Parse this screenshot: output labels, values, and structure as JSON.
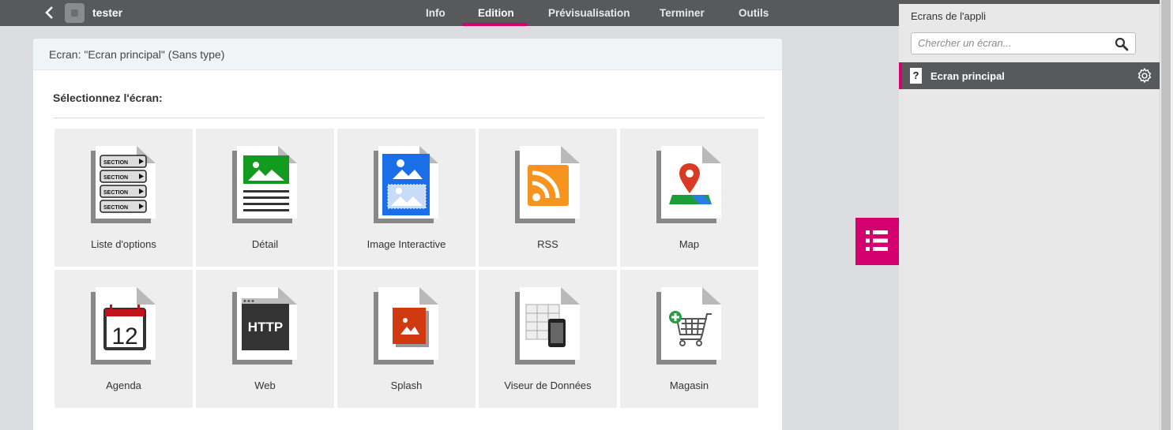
{
  "topbar": {
    "app_name": "tester",
    "tabs": [
      "Info",
      "Edition",
      "Prévisualisation",
      "Terminer",
      "Outils"
    ],
    "active_tab": "Edition"
  },
  "panel": {
    "header": "Ecran: \"Ecran principal\" (Sans type)",
    "section_title": "Sélectionnez l'écran:"
  },
  "screen_types": [
    {
      "label": "Liste d'options",
      "icon": "list-options-icon"
    },
    {
      "label": "Détail",
      "icon": "detail-icon"
    },
    {
      "label": "Image Interactive",
      "icon": "interactive-image-icon"
    },
    {
      "label": "RSS",
      "icon": "rss-icon"
    },
    {
      "label": "Map",
      "icon": "map-icon"
    },
    {
      "label": "Agenda",
      "icon": "calendar-icon"
    },
    {
      "label": "Web",
      "icon": "http-icon"
    },
    {
      "label": "Splash",
      "icon": "splash-icon"
    },
    {
      "label": "Viseur de Données",
      "icon": "data-viewer-icon"
    },
    {
      "label": "Magasin",
      "icon": "shopping-cart-icon"
    }
  ],
  "icon_text": {
    "section": "SECTION",
    "calendar_day": "12",
    "http": "HTTP"
  },
  "sidebar": {
    "title": "Ecrans de l'appli",
    "search_placeholder": "Chercher un écran...",
    "screens": [
      {
        "name": "Ecran principal",
        "icon": "?"
      }
    ]
  },
  "colors": {
    "accent": "#d4006d",
    "topbar": "#58595b"
  }
}
